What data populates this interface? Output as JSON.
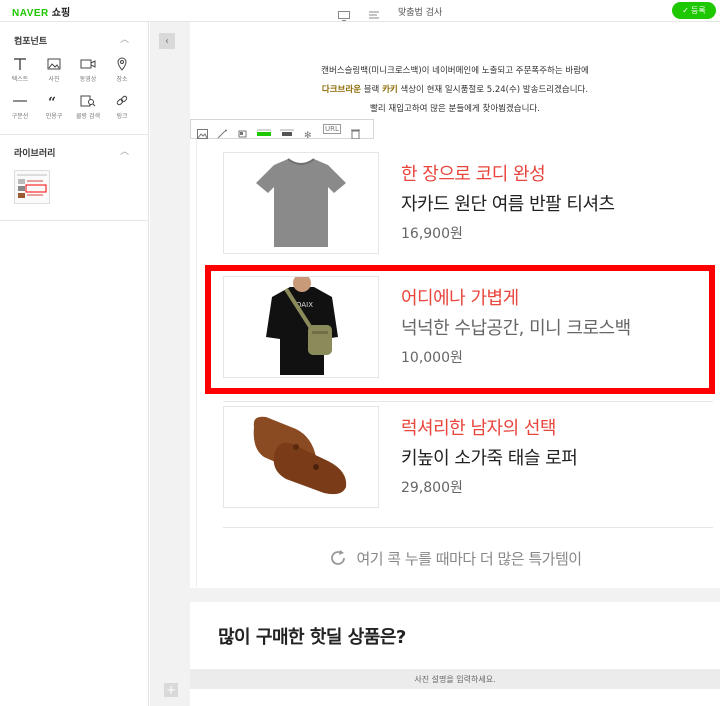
{
  "topbar": {
    "brand_naver": "NAVER",
    "brand_shop": "쇼핑",
    "spell_check": "맞춤법 검사",
    "register": "등록"
  },
  "sidebar": {
    "components_title": "컴포넌트",
    "tools": [
      {
        "icon": "text-icon",
        "label": "텍스트"
      },
      {
        "icon": "photo-icon",
        "label": "사진"
      },
      {
        "icon": "video-icon",
        "label": "동영상"
      },
      {
        "icon": "place-icon",
        "label": "장소"
      },
      {
        "icon": "divider-line-icon",
        "label": "구분선"
      },
      {
        "icon": "quote-icon",
        "label": "인용구"
      },
      {
        "icon": "product-search-icon",
        "label": "쿨랑 검색"
      },
      {
        "icon": "link-icon",
        "label": "링크"
      }
    ],
    "library_title": "라이브러리"
  },
  "editor": {
    "intro_line1": "캔버스슬링백(미니크로스백)이 네이버메인에 노출되고 주문폭주하는 바람에",
    "intro_line2_hl1": "다크브라운",
    "intro_line2_mid": " 블랙 ",
    "intro_line2_hl2": "카키",
    "intro_line2_rest": " 색상이 현재 일시품절로 5.24(수) 발송드리겠습니다.",
    "intro_line3": "빨리 재입고하여 많은 분들에게 찾아뵙겠습니다.",
    "toolbar_url": "URL",
    "products": [
      {
        "headline": "한 장으로 코디 완성",
        "name": "자카드 원단 여름 반팔 티셔츠",
        "price": "16,900원"
      },
      {
        "headline": "어디에나 가볍게",
        "name": "넉넉한 수납공간, 미니 크로스백",
        "price": "10,000원"
      },
      {
        "headline": "럭셔리한 남자의 선택",
        "name": "키높이 소가죽 태슬 로퍼",
        "price": "29,800원"
      }
    ],
    "more_text": "여기 콕 누를 때마다 더 많은 특가템이",
    "deal_title": "많이 구매한 핫딜 상품은?",
    "caption_placeholder": "사진 설명을 입력하세요."
  },
  "colors": {
    "brand_green": "#1ec800",
    "headline_red": "#e8463c",
    "highlight_red": "#ff0000"
  }
}
